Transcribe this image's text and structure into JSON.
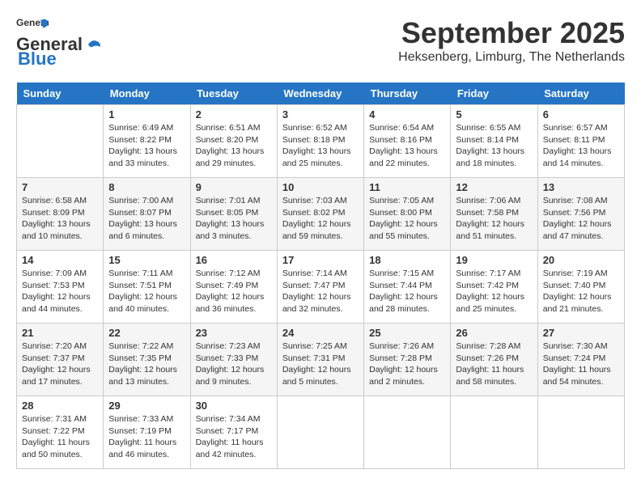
{
  "header": {
    "logo_line1": "General",
    "logo_line2": "Blue",
    "month": "September 2025",
    "location": "Heksenberg, Limburg, The Netherlands"
  },
  "days_of_week": [
    "Sunday",
    "Monday",
    "Tuesday",
    "Wednesday",
    "Thursday",
    "Friday",
    "Saturday"
  ],
  "weeks": [
    [
      {
        "day": null
      },
      {
        "day": 1,
        "sunrise": "6:49 AM",
        "sunset": "8:22 PM",
        "daylight": "13 hours and 33 minutes."
      },
      {
        "day": 2,
        "sunrise": "6:51 AM",
        "sunset": "8:20 PM",
        "daylight": "13 hours and 29 minutes."
      },
      {
        "day": 3,
        "sunrise": "6:52 AM",
        "sunset": "8:18 PM",
        "daylight": "13 hours and 25 minutes."
      },
      {
        "day": 4,
        "sunrise": "6:54 AM",
        "sunset": "8:16 PM",
        "daylight": "13 hours and 22 minutes."
      },
      {
        "day": 5,
        "sunrise": "6:55 AM",
        "sunset": "8:14 PM",
        "daylight": "13 hours and 18 minutes."
      },
      {
        "day": 6,
        "sunrise": "6:57 AM",
        "sunset": "8:11 PM",
        "daylight": "13 hours and 14 minutes."
      }
    ],
    [
      {
        "day": 7,
        "sunrise": "6:58 AM",
        "sunset": "8:09 PM",
        "daylight": "13 hours and 10 minutes."
      },
      {
        "day": 8,
        "sunrise": "7:00 AM",
        "sunset": "8:07 PM",
        "daylight": "13 hours and 6 minutes."
      },
      {
        "day": 9,
        "sunrise": "7:01 AM",
        "sunset": "8:05 PM",
        "daylight": "13 hours and 3 minutes."
      },
      {
        "day": 10,
        "sunrise": "7:03 AM",
        "sunset": "8:02 PM",
        "daylight": "12 hours and 59 minutes."
      },
      {
        "day": 11,
        "sunrise": "7:05 AM",
        "sunset": "8:00 PM",
        "daylight": "12 hours and 55 minutes."
      },
      {
        "day": 12,
        "sunrise": "7:06 AM",
        "sunset": "7:58 PM",
        "daylight": "12 hours and 51 minutes."
      },
      {
        "day": 13,
        "sunrise": "7:08 AM",
        "sunset": "7:56 PM",
        "daylight": "12 hours and 47 minutes."
      }
    ],
    [
      {
        "day": 14,
        "sunrise": "7:09 AM",
        "sunset": "7:53 PM",
        "daylight": "12 hours and 44 minutes."
      },
      {
        "day": 15,
        "sunrise": "7:11 AM",
        "sunset": "7:51 PM",
        "daylight": "12 hours and 40 minutes."
      },
      {
        "day": 16,
        "sunrise": "7:12 AM",
        "sunset": "7:49 PM",
        "daylight": "12 hours and 36 minutes."
      },
      {
        "day": 17,
        "sunrise": "7:14 AM",
        "sunset": "7:47 PM",
        "daylight": "12 hours and 32 minutes."
      },
      {
        "day": 18,
        "sunrise": "7:15 AM",
        "sunset": "7:44 PM",
        "daylight": "12 hours and 28 minutes."
      },
      {
        "day": 19,
        "sunrise": "7:17 AM",
        "sunset": "7:42 PM",
        "daylight": "12 hours and 25 minutes."
      },
      {
        "day": 20,
        "sunrise": "7:19 AM",
        "sunset": "7:40 PM",
        "daylight": "12 hours and 21 minutes."
      }
    ],
    [
      {
        "day": 21,
        "sunrise": "7:20 AM",
        "sunset": "7:37 PM",
        "daylight": "12 hours and 17 minutes."
      },
      {
        "day": 22,
        "sunrise": "7:22 AM",
        "sunset": "7:35 PM",
        "daylight": "12 hours and 13 minutes."
      },
      {
        "day": 23,
        "sunrise": "7:23 AM",
        "sunset": "7:33 PM",
        "daylight": "12 hours and 9 minutes."
      },
      {
        "day": 24,
        "sunrise": "7:25 AM",
        "sunset": "7:31 PM",
        "daylight": "12 hours and 5 minutes."
      },
      {
        "day": 25,
        "sunrise": "7:26 AM",
        "sunset": "7:28 PM",
        "daylight": "12 hours and 2 minutes."
      },
      {
        "day": 26,
        "sunrise": "7:28 AM",
        "sunset": "7:26 PM",
        "daylight": "11 hours and 58 minutes."
      },
      {
        "day": 27,
        "sunrise": "7:30 AM",
        "sunset": "7:24 PM",
        "daylight": "11 hours and 54 minutes."
      }
    ],
    [
      {
        "day": 28,
        "sunrise": "7:31 AM",
        "sunset": "7:22 PM",
        "daylight": "11 hours and 50 minutes."
      },
      {
        "day": 29,
        "sunrise": "7:33 AM",
        "sunset": "7:19 PM",
        "daylight": "11 hours and 46 minutes."
      },
      {
        "day": 30,
        "sunrise": "7:34 AM",
        "sunset": "7:17 PM",
        "daylight": "11 hours and 42 minutes."
      },
      {
        "day": null
      },
      {
        "day": null
      },
      {
        "day": null
      },
      {
        "day": null
      }
    ]
  ],
  "labels": {
    "sunrise_prefix": "Sunrise:",
    "sunset_prefix": "Sunset:",
    "daylight_prefix": "Daylight:"
  }
}
